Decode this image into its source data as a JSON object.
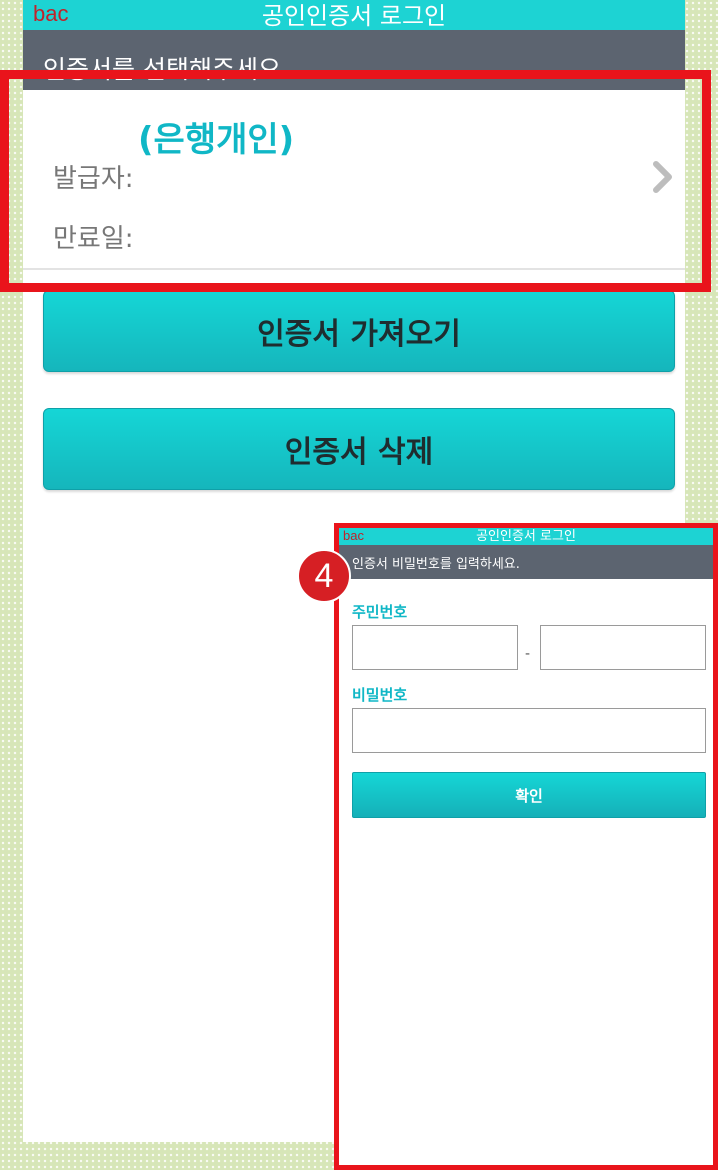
{
  "main_screen": {
    "app_tag": "bac",
    "title": "공인인증서 로그인",
    "subtitle": "인증서를 선택해주세요.",
    "cert": {
      "name": "(은행개인)",
      "issuer_label": "발급자:",
      "expiry_label": "만료일:"
    },
    "buttons": {
      "import_label": "인증서 가져오기",
      "delete_label": "인증서 삭제"
    }
  },
  "inset_screen": {
    "app_tag": "bac",
    "title": "공인인증서 로그인",
    "subtitle": "인증서 비밀번호를 입력하세요.",
    "resident_label": "주민번호",
    "resident_separator": "-",
    "password_label": "비밀번호",
    "confirm_label": "확인"
  },
  "step_badge": "4",
  "colors": {
    "accent": "#10b7c6",
    "titlebar": "#1dd3d3",
    "subbar": "#5c6470",
    "highlight": "#e9141b",
    "app_tag": "#c0232b"
  },
  "icons": [
    "chevron-right-icon"
  ]
}
